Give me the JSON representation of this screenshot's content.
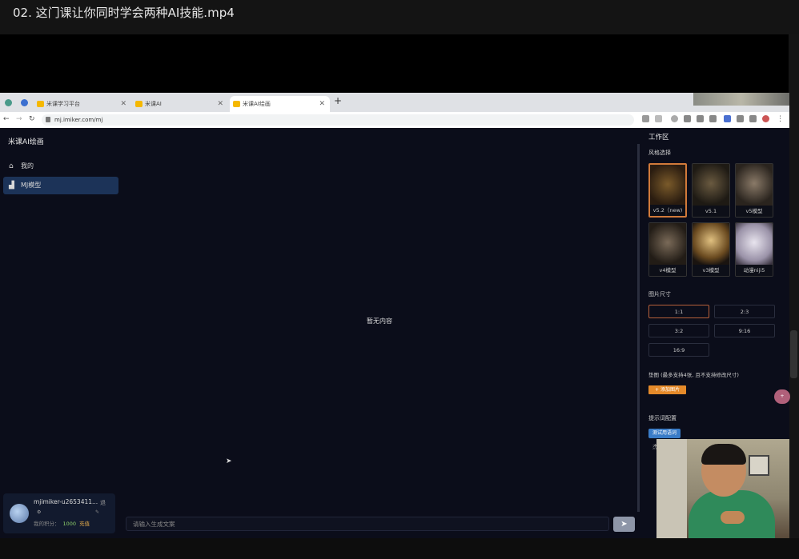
{
  "player": {
    "title": "02. 这门课让你同时学会两种AI技能.mp4"
  },
  "browser": {
    "tabs": [
      {
        "label": "米课学习平台"
      },
      {
        "label": "米课AI"
      },
      {
        "label": "米课AI绘画"
      }
    ],
    "url": "mj.imiker.com/mj"
  },
  "app": {
    "logo": "米课AI绘画",
    "menu": [
      {
        "label": "我的",
        "icon": "home-icon"
      },
      {
        "label": "MJ模型",
        "icon": "chart-icon"
      }
    ],
    "empty_text": "暂无内容",
    "prompt_placeholder": "请输入生成文案",
    "user": {
      "name": "mjimiker-u2653411...",
      "exit": "退",
      "points_label": "我的积分：",
      "points_value": "1000",
      "recharge": "充值"
    }
  },
  "panel": {
    "title": "工作区",
    "style_section": "风格选择",
    "styles": [
      {
        "label": "v5.2（new)"
      },
      {
        "label": "v5.1"
      },
      {
        "label": "v5模型"
      },
      {
        "label": "v4模型"
      },
      {
        "label": "v3模型"
      },
      {
        "label": "动漫niji5"
      }
    ],
    "size_section": "图片尺寸",
    "sizes": [
      "1:1",
      "2:3",
      "3:2",
      "9:16",
      "16:9"
    ],
    "pad_section": "垫图 (最多支持4张, 且不支持修改尺寸)",
    "add_image": "+ 添加图片",
    "prompt_section": "提示词配置",
    "test_button": "测试用语词",
    "fragment": "杰",
    "float_label": "+"
  }
}
